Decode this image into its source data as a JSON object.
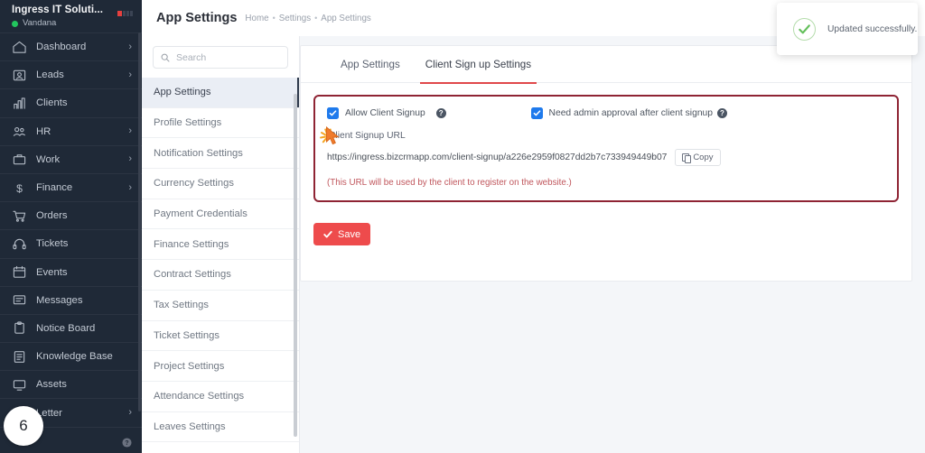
{
  "sidebar": {
    "org_name": "Ingress IT Soluti...",
    "user_name": "Vandana",
    "items": [
      {
        "label": "Dashboard",
        "icon": "home-icon",
        "chevron": "›"
      },
      {
        "label": "Leads",
        "icon": "leads-icon",
        "chevron": "›"
      },
      {
        "label": "Clients",
        "icon": "clients-icon",
        "chevron": ""
      },
      {
        "label": "HR",
        "icon": "people-icon",
        "chevron": "›"
      },
      {
        "label": "Work",
        "icon": "briefcase-icon",
        "chevron": "›"
      },
      {
        "label": "Finance",
        "icon": "dollar-icon",
        "chevron": "›"
      },
      {
        "label": "Orders",
        "icon": "cart-icon",
        "chevron": ""
      },
      {
        "label": "Tickets",
        "icon": "headset-icon",
        "chevron": ""
      },
      {
        "label": "Events",
        "icon": "calendar-icon",
        "chevron": ""
      },
      {
        "label": "Messages",
        "icon": "message-icon",
        "chevron": ""
      },
      {
        "label": "Notice Board",
        "icon": "clipboard-icon",
        "chevron": ""
      },
      {
        "label": "Knowledge Base",
        "icon": "book-icon",
        "chevron": ""
      },
      {
        "label": "Assets",
        "icon": "monitor-icon",
        "chevron": ""
      },
      {
        "label": "Letter",
        "icon": "letter-icon",
        "chevron": "›"
      }
    ],
    "help_icon": "question-circle-icon",
    "click_badge": "6"
  },
  "topbar": {
    "title": "App Settings",
    "breadcrumb": [
      "Home",
      "Settings",
      "App Settings"
    ],
    "separator": "•",
    "search_icon": "search-icon"
  },
  "settings_panel": {
    "search_placeholder": "Search",
    "search_icon": "search-icon",
    "items": [
      {
        "label": "App Settings",
        "active": true
      },
      {
        "label": "Profile Settings",
        "active": false
      },
      {
        "label": "Notification Settings",
        "active": false
      },
      {
        "label": "Currency Settings",
        "active": false
      },
      {
        "label": "Payment Credentials",
        "active": false
      },
      {
        "label": "Finance Settings",
        "active": false
      },
      {
        "label": "Contract Settings",
        "active": false
      },
      {
        "label": "Tax Settings",
        "active": false
      },
      {
        "label": "Ticket Settings",
        "active": false
      },
      {
        "label": "Project Settings",
        "active": false
      },
      {
        "label": "Attendance Settings",
        "active": false
      },
      {
        "label": "Leaves Settings",
        "active": false
      }
    ]
  },
  "main": {
    "tabs": [
      {
        "label": "App Settings",
        "active": false
      },
      {
        "label": "Client Sign up Settings",
        "active": true
      }
    ],
    "allow_signup": {
      "label": "Allow Client Signup",
      "checked": true,
      "help_icon": "question-circle-icon"
    },
    "admin_approval": {
      "label": "Need admin approval after client signup",
      "checked": true,
      "help_icon": "question-circle-icon"
    },
    "url_field": {
      "label": "Client Signup URL",
      "value": "https://ingress.bizcrmapp.com/client-signup/a226e2959f0827dd2b7c733949449b07",
      "copy_label": "Copy",
      "copy_icon": "copy-icon",
      "hint": "(This URL will be used by the client to register on the website.)"
    },
    "save_label": "Save",
    "save_icon": "check-icon"
  },
  "toast": {
    "message": "Updated successfully.",
    "icon": "check-circle-icon"
  },
  "colors": {
    "sidebar_bg": "#1f2937",
    "accent_red": "#ee4b4c",
    "highlight_border": "#8f2434",
    "checkbox_blue": "#1f7aec",
    "online_green": "#22c55e",
    "hint_red": "#c0565c"
  }
}
